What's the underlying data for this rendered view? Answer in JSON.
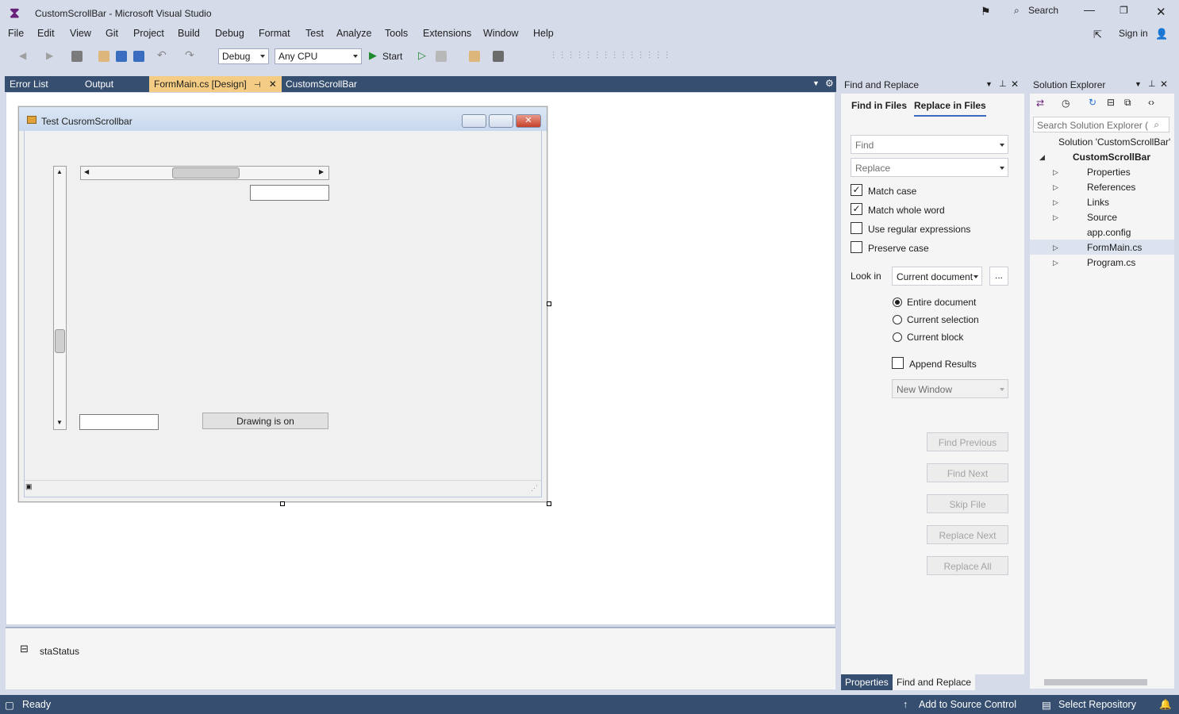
{
  "window": {
    "title": "CustomScrollBar - Microsoft Visual Studio",
    "search_label": "Search",
    "sign_in": "Sign in"
  },
  "menu": [
    "File",
    "Edit",
    "View",
    "Git",
    "Project",
    "Build",
    "Debug",
    "Format",
    "Test",
    "Analyze",
    "Tools",
    "Extensions",
    "Window",
    "Help"
  ],
  "toolbar": {
    "config": "Debug",
    "platform": "Any CPU",
    "start": "Start"
  },
  "tabs": [
    "Error List",
    "Output",
    "FormMain.cs [Design]",
    "CustomScrollBar"
  ],
  "form": {
    "title": "Test CusromScrollbar",
    "button_label": "Drawing is on"
  },
  "tray": {
    "component": "staStatus"
  },
  "find": {
    "panel_title": "Find and Replace",
    "tab_find": "Find in Files",
    "tab_replace": "Replace in Files",
    "find_placeholder": "Find",
    "replace_placeholder": "Replace",
    "match_case": "Match case",
    "match_whole_word": "Match whole word",
    "use_regex": "Use regular expressions",
    "preserve_case": "Preserve case",
    "look_in_label": "Look in",
    "look_in_value": "Current document",
    "browse": "...",
    "scope_entire": "Entire document",
    "scope_selection": "Current selection",
    "scope_block": "Current block",
    "append_results": "Append Results",
    "output_window": "New Window",
    "btn_find_prev": "Find Previous",
    "btn_find_next": "Find Next",
    "btn_skip": "Skip File",
    "btn_replace_next": "Replace Next",
    "btn_replace_all": "Replace All"
  },
  "bottom_tabs": [
    "Properties",
    "Find and Replace"
  ],
  "solution": {
    "panel_title": "Solution Explorer",
    "search_placeholder": "Search Solution Explorer (",
    "items": [
      "Solution 'CustomScrollBar'",
      "CustomScrollBar",
      "Properties",
      "References",
      "Links",
      "Source",
      "app.config",
      "FormMain.cs",
      "Program.cs"
    ]
  },
  "status": {
    "ready": "Ready",
    "source_control": "Add to Source Control",
    "repo": "Select Repository"
  }
}
